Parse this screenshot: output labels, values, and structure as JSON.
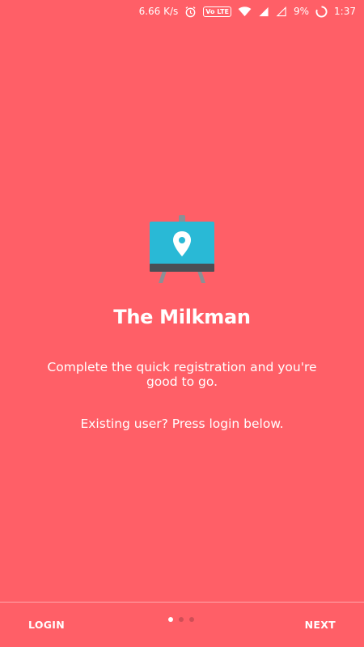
{
  "status_bar": {
    "net_speed": "6.66 K/s",
    "volte_label": "Vo LTE",
    "battery": "9%",
    "time": "1:37"
  },
  "main": {
    "app_icon": "map-pin-board-icon",
    "title": "The Milkman",
    "description": "Complete the quick registration and you're good to go.",
    "existing_user": "Existing user? Press login below."
  },
  "bottom_bar": {
    "login_label": "LOGIN",
    "next_label": "NEXT",
    "page_indicator": {
      "total": 3,
      "active_index": 0
    }
  },
  "colors": {
    "background": "#ff5f67",
    "icon_screen": "#29b9d6",
    "icon_base": "#4a4f55",
    "icon_stand": "#8b8f95"
  }
}
